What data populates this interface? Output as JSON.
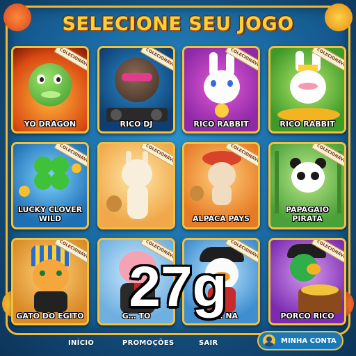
{
  "header": {
    "title": "SELECIONE SEU JOGO"
  },
  "badge_text": "COLECIONÁVEL",
  "games": [
    {
      "name": "YO DRAGON",
      "icon": "dragon-icon"
    },
    {
      "name": "RICO DJ",
      "icon": "gorilla-dj-icon"
    },
    {
      "name": "RICO RABBIT",
      "icon": "rabbit-icon"
    },
    {
      "name": "RICO RABBIT",
      "icon": "rabbit-crown-icon"
    },
    {
      "name": "LUCKY CLOVER WILD",
      "icon": "clover-icon"
    },
    {
      "name": "",
      "icon": "llama-icon"
    },
    {
      "name": "ALPACA PAYS",
      "icon": "alpaca-icon"
    },
    {
      "name": "PAPAGAIO PIRATA",
      "icon": "panda-icon"
    },
    {
      "name": "GATO DO EGITO",
      "icon": "pharaoh-cat-icon"
    },
    {
      "name": "G… TO",
      "icon": "pig-icon"
    },
    {
      "name": "PA… NA",
      "icon": "pirate-duck-icon"
    },
    {
      "name": "PORCO RICO",
      "icon": "parrot-pirate-icon"
    }
  ],
  "nav": {
    "inicio": "INÍCIO",
    "promocoes": "PROMOÇÕES",
    "sair": "SAIR",
    "account": "MINHA CONTA"
  },
  "overlay_text": "27g",
  "colors": {
    "frame_gold": "#f3c13a",
    "background_blue": "#1a6aa3",
    "title_yellow": "#ffcf3a"
  }
}
